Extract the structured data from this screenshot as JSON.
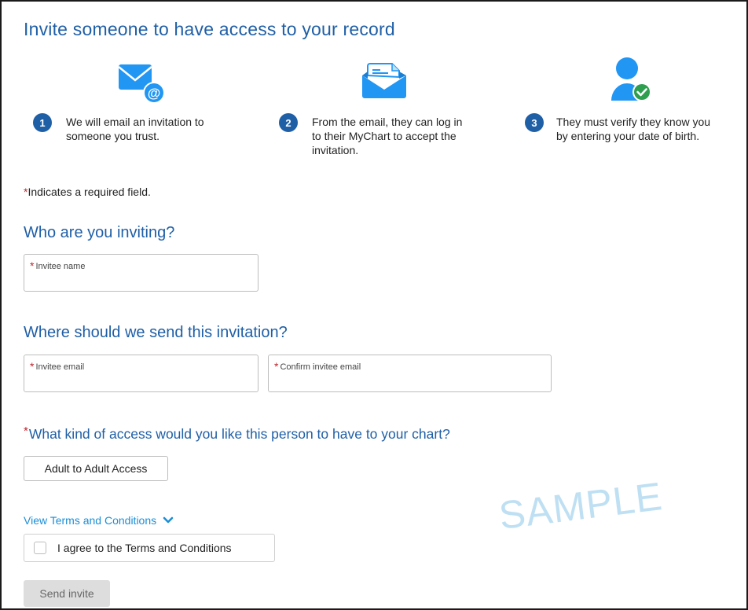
{
  "title": "Invite someone to have access to your record",
  "steps": [
    {
      "number": "1",
      "line1": "We will email an invitation to",
      "line2": "someone you trust.",
      "line3": "",
      "icon": "email-at-icon"
    },
    {
      "number": "2",
      "line1": "From the email, they can log in",
      "line2": "to their MyChart to accept the",
      "line3": "invitation.",
      "icon": "open-envelope-icon"
    },
    {
      "number": "3",
      "line1": "They must verify they know you",
      "line2": "by entering your date of birth.",
      "line3": "",
      "icon": "verified-user-icon"
    }
  ],
  "required_note": "Indicates a required field.",
  "required_marker": "*",
  "who_heading": "Who are you inviting?",
  "invitee_name": {
    "label": "Invitee name",
    "value": ""
  },
  "where_heading": "Where should we send this invitation?",
  "invitee_email": {
    "label": "Invitee email",
    "value": ""
  },
  "confirm_email": {
    "label": "Confirm invitee email",
    "value": ""
  },
  "access_question": "What kind of access would you like this person to have to your chart?",
  "access_button": "Adult to Adult Access",
  "terms_link": "View Terms and Conditions",
  "agree_label": "I agree to the Terms and Conditions",
  "agree_checked": false,
  "send_button": "Send invite",
  "watermark": "SAMPLE",
  "colors": {
    "heading": "#1f5fa6",
    "required": "#c0262d",
    "link": "#1b8ed6",
    "icon": "#2196f3"
  }
}
